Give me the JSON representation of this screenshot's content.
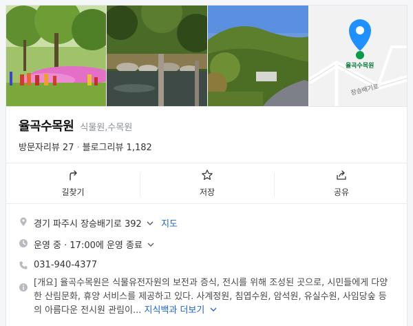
{
  "map": {
    "pin_label": "율곡수목원",
    "road_label": "장승배기로"
  },
  "place": {
    "name": "율곡수목원",
    "category": "식물원,수목원",
    "visitor_reviews": "방문자리뷰 27",
    "blog_reviews": "블로그리뷰 1,182"
  },
  "actions": [
    {
      "label": "길찾기",
      "icon": "directions-icon"
    },
    {
      "label": "저장",
      "icon": "star-icon"
    },
    {
      "label": "공유",
      "icon": "share-icon"
    }
  ],
  "info": {
    "address": "경기 파주시 장승배기로 392",
    "map_link": "지도",
    "hours": "운영 중 · 17:00에 운영 종료",
    "phone": "031-940-4377",
    "description": "[개요] 율곡수목원은 식물유전자원의 보전과 증식, 전시를 위해 조성된 곳으로, 시민들에게 다양한 산림문화, 휴양 서비스를 제공하고 있다. 사계정원, 침엽수원, 암석원, 유실수원, 사임당숲 등의 아름다운 전시원 관림이...",
    "more_link": "지식백과 더보기"
  },
  "colors": {
    "accent": "#1a63d8",
    "pin": "#1e90ff",
    "map_green": "#0a7a3b"
  }
}
